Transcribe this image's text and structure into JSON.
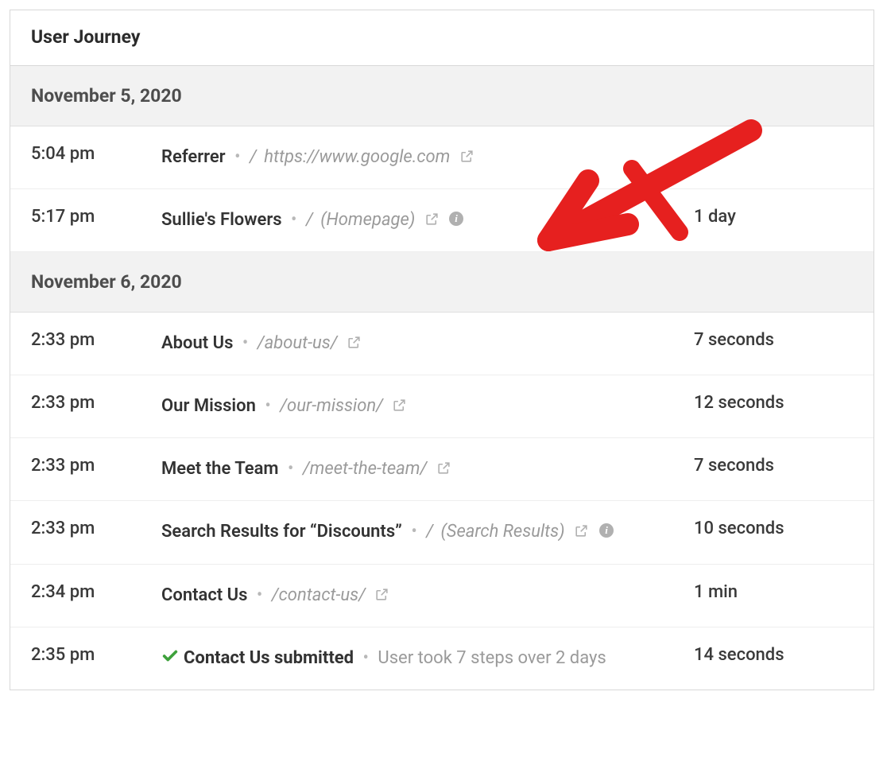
{
  "panel": {
    "title": "User Journey"
  },
  "groups": [
    {
      "date": "November 5, 2020",
      "rows": [
        {
          "time": "5:04 pm",
          "title": "Referrer",
          "slash": "/",
          "path": "https://www.google.com",
          "ext_link": true,
          "info": false,
          "duration": ""
        },
        {
          "time": "5:17 pm",
          "title": "Sullie's Flowers",
          "slash": "/",
          "path": "(Homepage)",
          "ext_link": true,
          "info": true,
          "duration": "1 day"
        }
      ]
    },
    {
      "date": "November 6, 2020",
      "rows": [
        {
          "time": "2:33 pm",
          "title": "About Us",
          "slash": "",
          "path": "/about-us/",
          "ext_link": true,
          "info": false,
          "duration": "7 seconds"
        },
        {
          "time": "2:33 pm",
          "title": "Our Mission",
          "slash": "",
          "path": "/our-mission/",
          "ext_link": true,
          "info": false,
          "duration": "12 seconds"
        },
        {
          "time": "2:33 pm",
          "title": "Meet the Team",
          "slash": "",
          "path": "/meet-the-team/",
          "ext_link": true,
          "info": false,
          "duration": "7 seconds"
        },
        {
          "time": "2:33 pm",
          "title": "Search Results for “Discounts”",
          "slash": "/",
          "path": "(Search Results)",
          "ext_link": true,
          "info": true,
          "duration": "10 seconds"
        },
        {
          "time": "2:34 pm",
          "title": "Contact Us",
          "slash": "",
          "path": "/contact-us/",
          "ext_link": true,
          "info": false,
          "duration": "1 min"
        },
        {
          "time": "2:35 pm",
          "title": "Contact Us submitted",
          "submitted": true,
          "summary": "User took 7 steps over 2 days",
          "duration": "14 seconds"
        }
      ]
    }
  ]
}
